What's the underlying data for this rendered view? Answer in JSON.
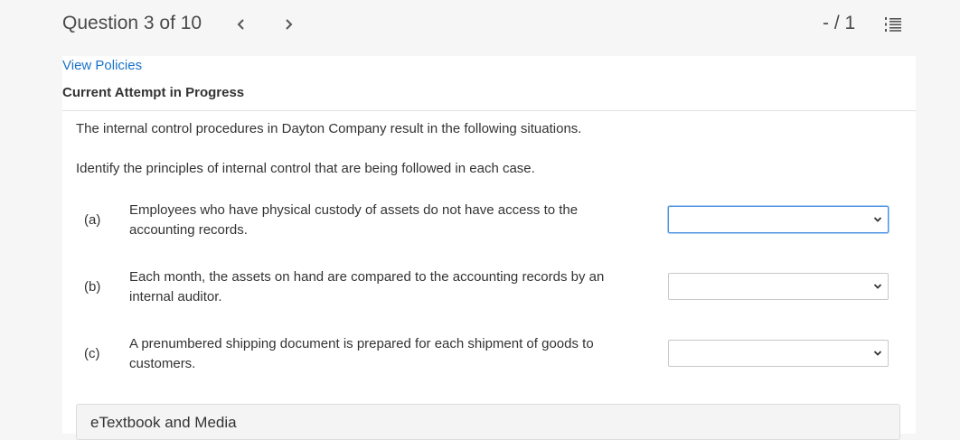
{
  "header": {
    "question_label": "Question 3 of 10",
    "score": "- / 1",
    "icons": {
      "prev": "chevron-left-icon",
      "next": "chevron-right-icon",
      "list": "numbered-list-icon"
    }
  },
  "links": {
    "view_policies": "View Policies"
  },
  "attempt_status": "Current Attempt in Progress",
  "question": {
    "intro": "The internal control procedures in Dayton Company result in the following situations.",
    "instruction": "Identify the principles of internal control that are being followed in each case.",
    "items": [
      {
        "letter": "(a)",
        "text": "Employees who have physical custody of assets do not have access to the accounting records.",
        "selected": ""
      },
      {
        "letter": "(b)",
        "text": "Each month, the assets on hand are compared to the accounting records by an internal auditor.",
        "selected": ""
      },
      {
        "letter": "(c)",
        "text": "A prenumbered shipping document is prepared for each shipment of goods to customers.",
        "selected": ""
      }
    ]
  },
  "panel": {
    "title": "eTextbook and Media"
  },
  "colors": {
    "link": "#1a73c9",
    "focus_border": "#4a90e2",
    "background": "#f6f6f6"
  }
}
